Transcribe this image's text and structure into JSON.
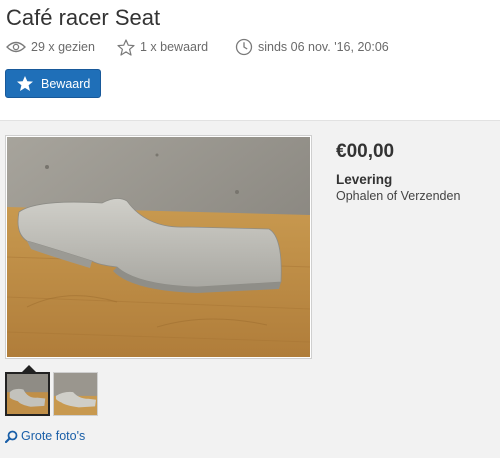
{
  "listing": {
    "title": "Café racer Seat",
    "stats": {
      "views": "29 x gezien",
      "saved": "1 x bewaard",
      "since": "sinds 06 nov. '16, 20:06"
    },
    "save_button_label": "Bewaard",
    "price": "€00,00",
    "delivery": {
      "label": "Levering",
      "value": "Ophalen of Verzenden"
    },
    "large_photos_link": "Grote foto's"
  },
  "icons": {
    "views": "eye-icon",
    "saved": "star-outline-icon",
    "since": "clock-icon",
    "save_button": "star-icon",
    "large_photos": "magnifier-icon"
  },
  "colors": {
    "save_button_bg": "#1f6fb8",
    "link": "#1a5fa8",
    "content_bg": "#f2f2f2"
  }
}
